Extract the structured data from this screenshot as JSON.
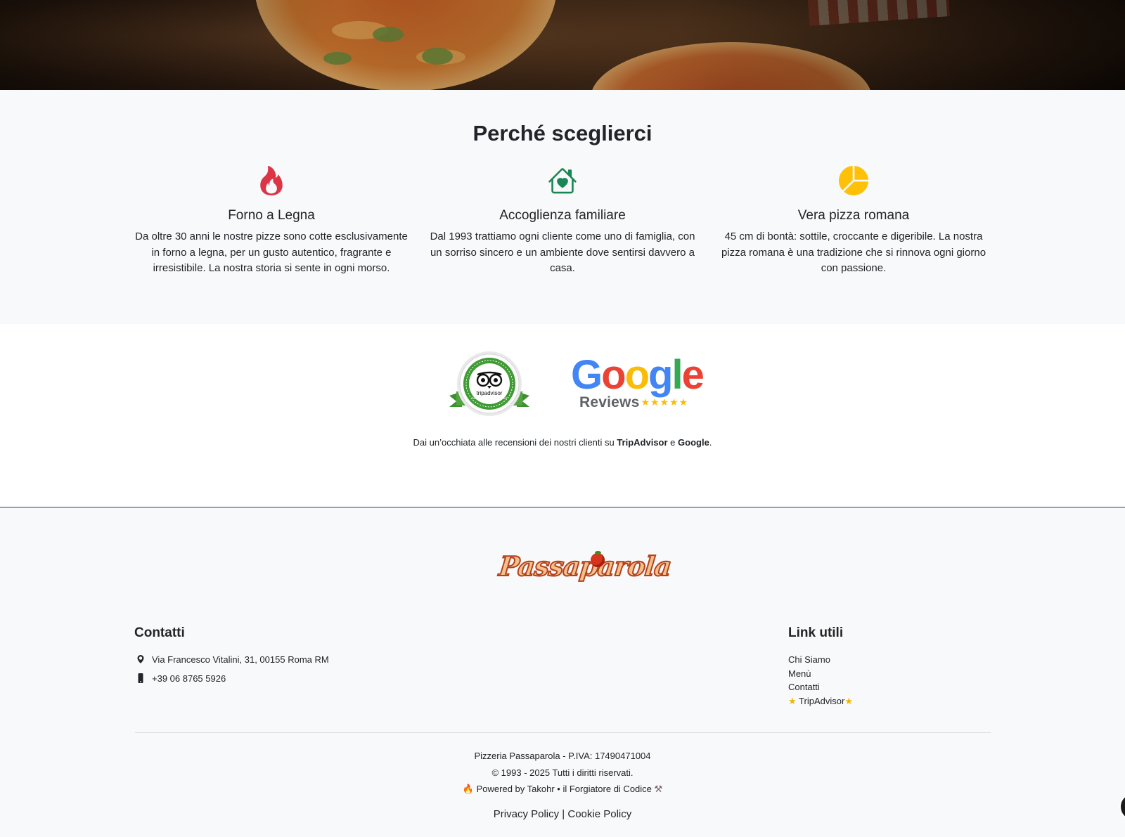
{
  "why": {
    "title": "Perché sceglierci",
    "features": [
      {
        "icon": "fire-icon",
        "color": "#dc3545",
        "title": "Forno a Legna",
        "text": "Da oltre 30 anni le nostre pizze sono cotte esclusivamente in forno a legna, per un gusto autentico, fragrante e irresistibile. La nostra storia si sente in ogni morso."
      },
      {
        "icon": "house-heart-icon",
        "color": "#198754",
        "title": "Accoglienza familiare",
        "text": "Dal 1993 trattiamo ogni cliente come uno di famiglia, con un sorriso sincero e un ambiente dove sentirsi davvero a casa."
      },
      {
        "icon": "pie-chart-icon",
        "color": "#ffc107",
        "title": "Vera pizza romana",
        "text": "45 cm di bontà: sottile, croccante e digeribile. La nostra pizza romana è una tradizione che si rinnova ogni giorno con passione."
      }
    ]
  },
  "reviews": {
    "tripadvisor_badge": "tripadvisor",
    "google_word": [
      "G",
      "o",
      "o",
      "g",
      "l",
      "e"
    ],
    "google_sub": "Reviews",
    "google_stars": "★★★★★",
    "note_prefix": "Dai un’occhiata alle recensioni dei nostri clienti su ",
    "note_tripadvisor": "TripAdvisor",
    "note_and": " e ",
    "note_google": "Google",
    "note_suffix": "."
  },
  "footer": {
    "logo": "Passaparola",
    "contacts_title": "Contatti",
    "address": "Via Francesco Vitalini, 31, 00155 Roma RM",
    "phone": "+39 06 8765 5926",
    "links_title": "Link utili",
    "links": [
      "Chi Siamo",
      "Menù",
      "Contatti"
    ],
    "tripadvisor_link": "TripAdvisor",
    "company": "Pizzeria Passaparola - P.IVA: 17490471004",
    "copyright": "© 1993 - 2025 Tutti i diritti riservati.",
    "powered": "Powered by Takohr • il Forgiatore di Codice",
    "privacy": "Privacy Policy",
    "separator": " | ",
    "cookie": "Cookie Policy"
  },
  "colors": {
    "google_blue": "#4285F4",
    "google_red": "#EA4335",
    "google_yellow": "#FBBC05",
    "google_green": "#34A853",
    "tripadvisor_green": "#34a346"
  }
}
